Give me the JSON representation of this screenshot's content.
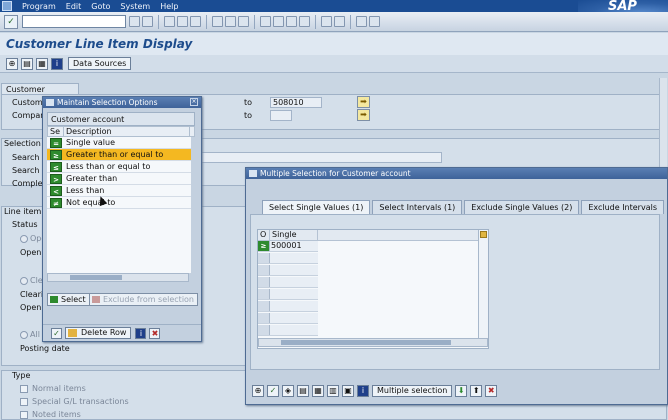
{
  "menu": [
    "Program",
    "Edit",
    "Goto",
    "System",
    "Help"
  ],
  "logo": "SAP",
  "screen_title": "Customer Line Item Display",
  "app_toolbar": {
    "data_sources": "Data Sources"
  },
  "customer_selection": {
    "title": "Customer selection",
    "customer_label": "Customer account",
    "company_label": "Company code",
    "to1": "to",
    "to2": "to",
    "customer_to_value": "508010"
  },
  "selection_using": {
    "title": "Selection using search help",
    "search_help_id": "Search help ID",
    "search_string": "Search string",
    "complex_search": "Complex search help"
  },
  "line_item_selection": {
    "title": "Line item selection",
    "status_title": "Status",
    "open_items": "Open items",
    "open_at_key_date": "Open at key date",
    "cleared_items": "Cleared items",
    "clearing_date": "Clearing date",
    "open_at_key_date2": "Open at key date",
    "all_items": "All items",
    "posting_date": "Posting date"
  },
  "type_section": {
    "title": "Type",
    "normal_items": "Normal items",
    "special_gl": "Special G/L transactions",
    "noted_items": "Noted items"
  },
  "maintain_dialog": {
    "title": "Maintain Selection Options",
    "table_title": "Customer account",
    "col_se": "Se",
    "col_desc": "Description",
    "options": [
      {
        "icon": "=",
        "label": "Single value",
        "color": "green",
        "selected": false
      },
      {
        "icon": "≥",
        "label": "Greater than or equal to",
        "color": "green",
        "selected": true
      },
      {
        "icon": "≤",
        "label": "Less than or equal to",
        "color": "green",
        "selected": false
      },
      {
        "icon": ">",
        "label": "Greater than",
        "color": "green",
        "selected": false
      },
      {
        "icon": "<",
        "label": "Less than",
        "color": "green",
        "selected": false
      },
      {
        "icon": "≠",
        "label": "Not equal to",
        "color": "green",
        "selected": false
      }
    ],
    "select_btn": "Select",
    "exclude_btn": "Exclude from selection",
    "delete_row": "Delete Row"
  },
  "multi_dialog": {
    "title": "Multiple Selection for Customer account",
    "tabs": [
      "Select Single Values (1)",
      "Select Intervals (1)",
      "Exclude Single Values (2)",
      "Exclude Intervals"
    ],
    "col_o": "O",
    "col_value": "Single value",
    "rows": [
      {
        "op": "≥",
        "value": "500001"
      },
      {
        "op": "",
        "value": ""
      },
      {
        "op": "",
        "value": ""
      },
      {
        "op": "",
        "value": ""
      },
      {
        "op": "",
        "value": ""
      },
      {
        "op": "",
        "value": ""
      },
      {
        "op": "",
        "value": ""
      },
      {
        "op": "",
        "value": ""
      }
    ],
    "multiple_selection_btn": "Multiple selection"
  },
  "colors": {
    "title_blue": "#1d4c8c",
    "menu_blue": "#1a4c93",
    "selected_row": "#f4b821",
    "green_icon": "#2e8a2e",
    "red_icon": "#b42a2a"
  }
}
